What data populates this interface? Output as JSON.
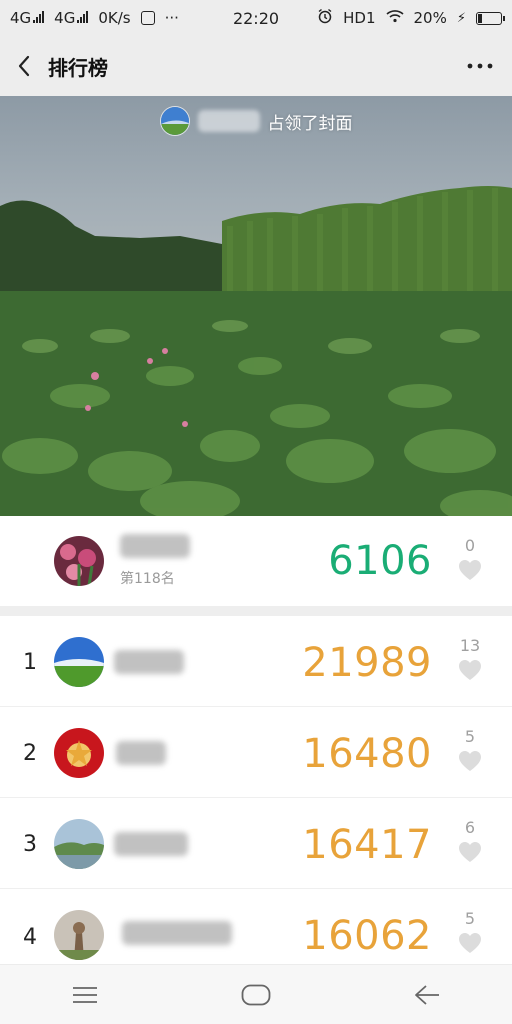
{
  "status_bar": {
    "network_left": "4G",
    "network_mid": "4G",
    "speed": "0K/s",
    "dots": "···",
    "time": "22:20",
    "hd_label": "HD1",
    "battery_percent": "20%",
    "battery_level": 0.2
  },
  "title_bar": {
    "title": "排行榜"
  },
  "cover": {
    "caption": "占领了封面"
  },
  "my_rank": {
    "rank_label": "第118名",
    "score": "6106",
    "likes": "0"
  },
  "leaderboard": [
    {
      "rank": "1",
      "score": "21989",
      "likes": "13"
    },
    {
      "rank": "2",
      "score": "16480",
      "likes": "5"
    },
    {
      "rank": "3",
      "score": "16417",
      "likes": "6"
    },
    {
      "rank": "4",
      "score": "16062",
      "likes": "5"
    }
  ],
  "colors": {
    "self_score": "#1aad75",
    "rank_score": "#e8a33a",
    "heart": "#dcdcdc"
  },
  "icons": [
    "back-arrow-icon",
    "more-dots-icon",
    "heart-icon",
    "menu-lines-icon",
    "home-icon",
    "back-triangle-icon"
  ]
}
